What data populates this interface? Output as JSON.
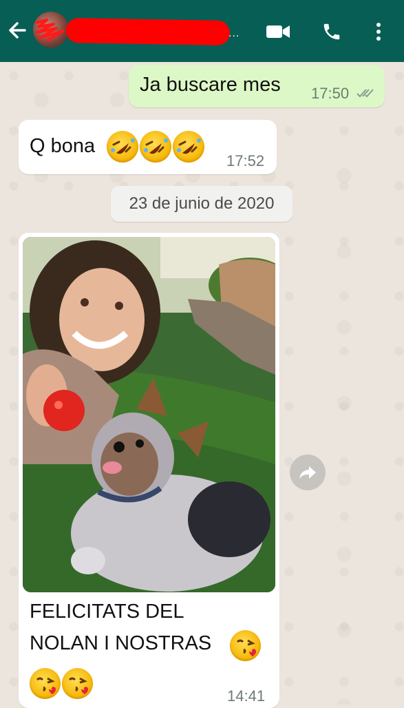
{
  "header": {
    "contact_name": "",
    "ellipsis": "...",
    "colors": {
      "bar": "#075e54",
      "redaction": "#ff0000"
    },
    "icons": [
      "arrow-back-icon",
      "video-call-icon",
      "phone-icon",
      "more-vert-icon"
    ]
  },
  "messages": [
    {
      "direction": "outgoing",
      "text": "Ja buscare mes",
      "time": "17:50",
      "status": "read-double-tick"
    },
    {
      "direction": "incoming",
      "text": "Q bona",
      "emoji": [
        "rolling-on-floor-laughing",
        "rolling-on-floor-laughing",
        "rolling-on-floor-laughing"
      ],
      "time": "17:52"
    }
  ],
  "date_separator": "23 de junio de 2020",
  "photo_message": {
    "direction": "incoming",
    "image": "photo-girl-with-yorkshire-terrier-dog",
    "caption_line1": "FELICITATS DEL",
    "caption_line2": "NOLAN I NOSTRAS",
    "caption_emoji": [
      "face-blowing-kiss",
      "face-blowing-kiss",
      "face-blowing-kiss"
    ],
    "time": "14:41"
  },
  "colors": {
    "outgoing_bubble": "#dcf8c6",
    "incoming_bubble": "#ffffff",
    "wallpaper": "#ece5dd"
  }
}
